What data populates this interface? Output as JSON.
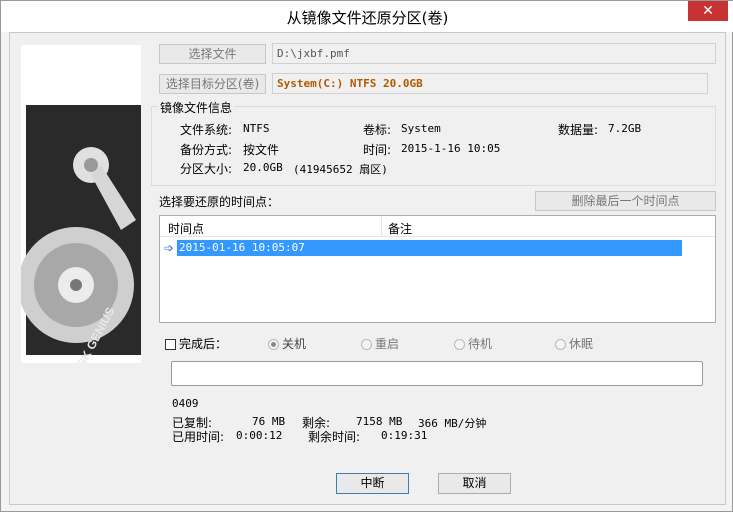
{
  "window": {
    "title": "从镜像文件还原分区(卷)",
    "close_glyph": "✕"
  },
  "source": {
    "select_file_label": "选择文件",
    "file_path": "D:\\jxbf.pmf",
    "select_target_label": "选择目标分区(卷)",
    "target_partition": "System(C:) NTFS 20.0GB"
  },
  "image_info": {
    "group_title": "镜像文件信息",
    "filesystem_label": "文件系统:",
    "filesystem_value": "NTFS",
    "volume_label": "卷标:",
    "volume_value": "System",
    "data_label": "数据量:",
    "data_value": "7.2GB",
    "backup_mode_label": "备份方式:",
    "backup_mode_value": "按文件",
    "time_label": "时间:",
    "time_value": "2015-1-16 10:05",
    "size_label": "分区大小:",
    "size_value": "20.0GB",
    "size_sectors": "(41945652 扇区)"
  },
  "timepoints": {
    "prompt": "选择要还原的时间点：",
    "delete_last_label": "删除最后一个时间点",
    "col_time": "时间点",
    "col_note": "备注",
    "rows": [
      {
        "time": "2015-01-16 10:05:07",
        "note": ""
      }
    ]
  },
  "after_completion": {
    "checkbox_label": "完成后：",
    "checked": false,
    "options": [
      "关机",
      "重启",
      "待机",
      "休眠"
    ],
    "selected": "关机"
  },
  "progress": {
    "fraction": 0,
    "code": "0409",
    "copied_label": "已复制:",
    "copied_value": "76 MB",
    "remaining_label": "剩余:",
    "remaining_value": "7158 MB",
    "speed": "366 MB/分钟",
    "elapsed_label": "已用时间:",
    "elapsed_value": "0:00:12",
    "left_time_label": "剩余时间:",
    "left_time_value": "0:19:31"
  },
  "buttons": {
    "abort_label": "中断",
    "cancel_label": "取消"
  },
  "brand": {
    "logo_text": "DISK GENIUS"
  }
}
